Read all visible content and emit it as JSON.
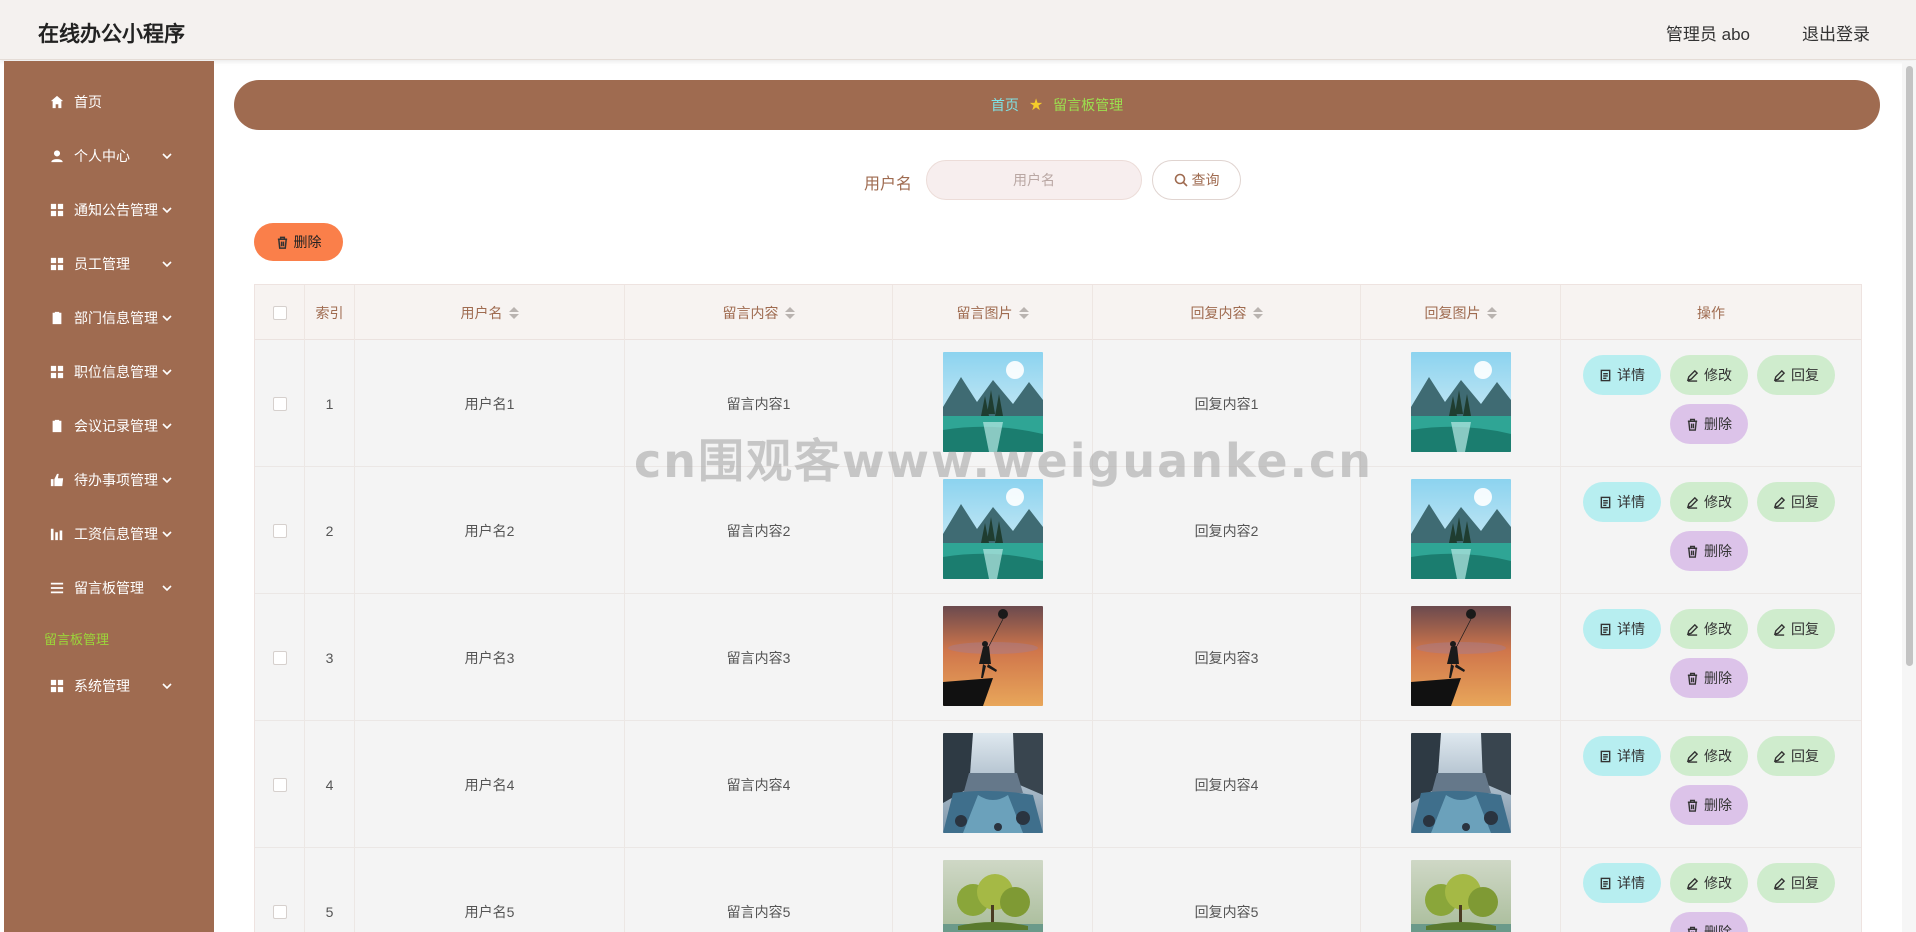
{
  "header": {
    "title": "在线办公小程序",
    "user_label": "管理员 abo",
    "logout_label": "退出登录"
  },
  "sidebar": {
    "items": [
      {
        "label": "首页",
        "icon": "home-icon"
      },
      {
        "label": "个人中心",
        "icon": "user-icon"
      },
      {
        "label": "通知公告管理",
        "icon": "grid-icon"
      },
      {
        "label": "员工管理",
        "icon": "grid-icon"
      },
      {
        "label": "部门信息管理",
        "icon": "clipboard-icon"
      },
      {
        "label": "职位信息管理",
        "icon": "grid-icon"
      },
      {
        "label": "会议记录管理",
        "icon": "clipboard-icon"
      },
      {
        "label": "待办事项管理",
        "icon": "thumb-icon"
      },
      {
        "label": "工资信息管理",
        "icon": "chart-icon"
      },
      {
        "label": "留言板管理",
        "icon": "list-icon"
      },
      {
        "label": "系统管理",
        "icon": "grid-icon"
      }
    ],
    "active_sub": "留言板管理"
  },
  "breadcrumb": {
    "home": "首页",
    "current": "留言板管理"
  },
  "search": {
    "label": "用户名",
    "placeholder": "用户名",
    "button": "查询"
  },
  "toolbar": {
    "delete_label": "删除"
  },
  "table": {
    "columns": [
      "索引",
      "用户名",
      "留言内容",
      "留言图片",
      "回复内容",
      "回复图片",
      "操作"
    ],
    "rows": [
      {
        "index": "1",
        "username": "用户名1",
        "content": "留言内容1",
        "reply": "回复内容1",
        "image": "lake-mountains"
      },
      {
        "index": "2",
        "username": "用户名2",
        "content": "留言内容2",
        "reply": "回复内容2",
        "image": "lake-mountains"
      },
      {
        "index": "3",
        "username": "用户名3",
        "content": "留言内容3",
        "reply": "回复内容3",
        "image": "girl-balloon-sunset"
      },
      {
        "index": "4",
        "username": "用户名4",
        "content": "留言内容4",
        "reply": "回复内容4",
        "image": "river-valley"
      },
      {
        "index": "5",
        "username": "用户名5",
        "content": "留言内容5",
        "reply": "回复内容5",
        "image": "island-trees"
      }
    ],
    "actions": {
      "detail": "详情",
      "edit": "修改",
      "reply": "回复",
      "delete": "删除"
    }
  },
  "watermark": "cn围观客www.weiguanke.cn",
  "colors": {
    "brand": "#9f6b50",
    "accent_green": "#9be04f",
    "accent_cyan": "#7fe3e6",
    "delete_orange": "#fa7f4a"
  }
}
